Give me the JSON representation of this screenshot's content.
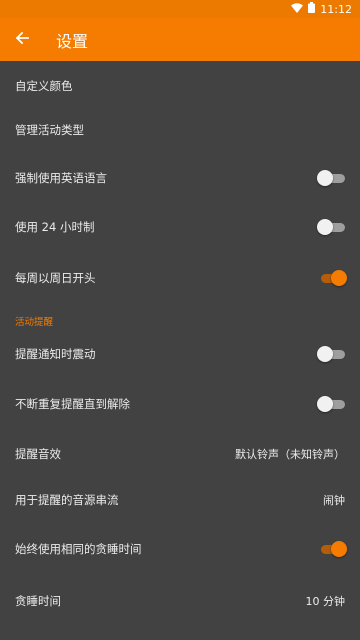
{
  "status_bar": {
    "time": "11:12"
  },
  "toolbar": {
    "title": "设置",
    "back_icon": "arrow-left-icon"
  },
  "colors": {
    "accent": "#F57C00",
    "background": "#424242",
    "text": "#ececec"
  },
  "settings": {
    "custom_colors": {
      "label": "自定义颜色"
    },
    "manage_activity_types": {
      "label": "管理活动类型"
    },
    "force_english": {
      "label": "强制使用英语语言",
      "enabled": false
    },
    "use_24h": {
      "label": "使用 24 小时制",
      "enabled": false
    },
    "week_starts_sunday": {
      "label": "每周以周日开头",
      "enabled": true
    }
  },
  "reminders": {
    "header": "活动提醒",
    "vibrate": {
      "label": "提醒通知时震动",
      "enabled": false
    },
    "repeat_until_dismissed": {
      "label": "不断重复提醒直到解除",
      "enabled": false
    },
    "sound": {
      "label": "提醒音效",
      "value": "默认铃声（未知铃声）"
    },
    "audio_stream": {
      "label": "用于提醒的音源串流",
      "value": "闹钟"
    },
    "same_snooze": {
      "label": "始终使用相同的贪睡时间",
      "enabled": true
    },
    "snooze_time": {
      "label": "贪睡时间",
      "value": "10 分钟"
    }
  }
}
